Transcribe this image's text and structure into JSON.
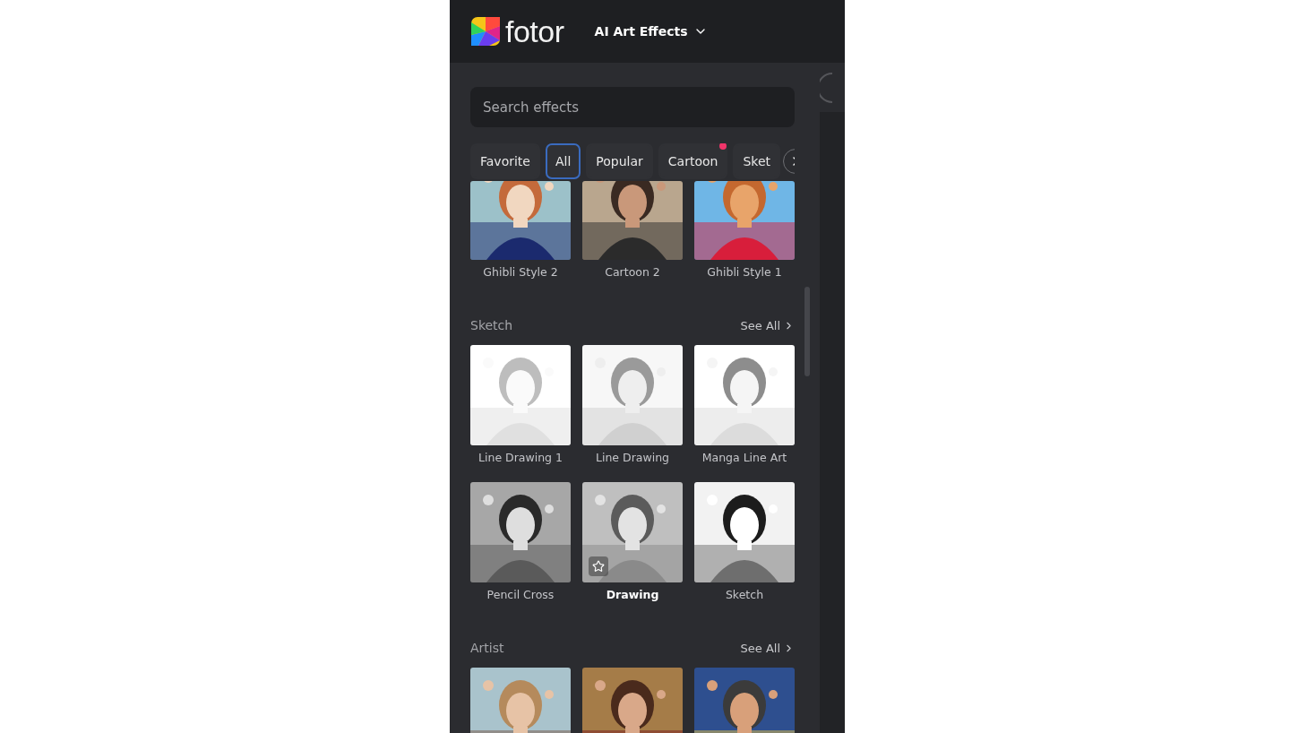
{
  "header": {
    "logo_text": "fotor",
    "menu_label": "AI Art Effects"
  },
  "search": {
    "placeholder": "Search effects"
  },
  "chips": [
    {
      "label": "Favorite",
      "selected": false,
      "new_dot": false
    },
    {
      "label": "All",
      "selected": true,
      "new_dot": false
    },
    {
      "label": "Popular",
      "selected": false,
      "new_dot": false
    },
    {
      "label": "Cartoon",
      "selected": false,
      "new_dot": true
    },
    {
      "label": "Sket",
      "selected": false,
      "new_dot": false
    }
  ],
  "sections": [
    {
      "items": [
        {
          "label": "Ghibli Style 2",
          "hovered": false
        },
        {
          "label": "Cartoon 2",
          "hovered": false
        },
        {
          "label": "Ghibli Style 1",
          "hovered": false
        }
      ]
    },
    {
      "title": "Sketch",
      "see_all": "See All",
      "items": [
        {
          "label": "Line Drawing 1",
          "hovered": false
        },
        {
          "label": "Line Drawing",
          "hovered": false
        },
        {
          "label": "Manga Line Art",
          "hovered": false
        },
        {
          "label": "Pencil Cross",
          "hovered": false
        },
        {
          "label": "Drawing",
          "hovered": true
        },
        {
          "label": "Sketch",
          "hovered": false
        }
      ]
    },
    {
      "title": "Artist",
      "see_all": "See All"
    }
  ]
}
